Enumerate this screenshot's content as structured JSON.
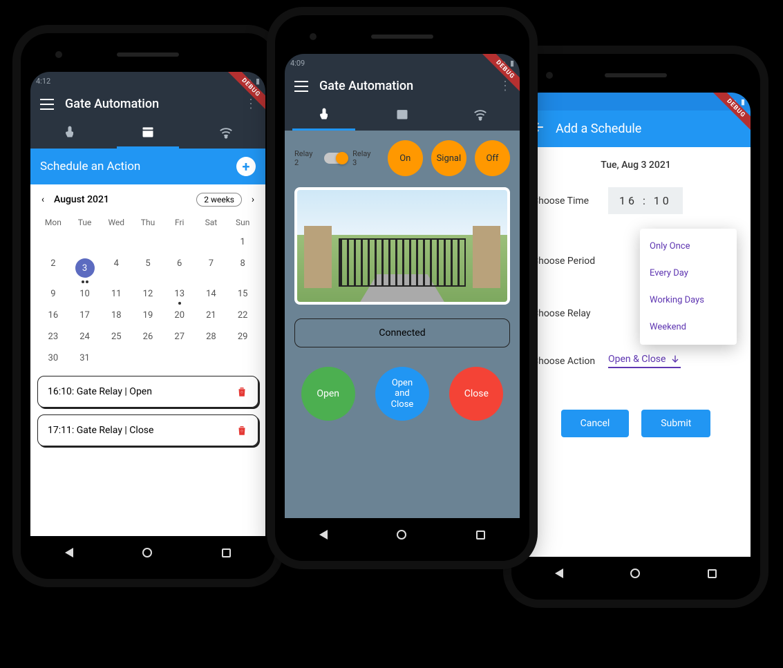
{
  "app_title": "Gate Automation",
  "debug_label": "DEBUG",
  "phone1": {
    "status_time": "4:12",
    "header": "Schedule an Action",
    "month_label": "August 2021",
    "range_chip": "2 weeks",
    "dow": [
      "Mon",
      "Tue",
      "Wed",
      "Thu",
      "Fri",
      "Sat",
      "Sun"
    ],
    "selected_day": 3,
    "event_day_with_dot": 13,
    "events": [
      "16:10: Gate Relay | Open",
      "17:11: Gate Relay | Close"
    ]
  },
  "phone2": {
    "status_time": "4:09",
    "relay_left_label": "Relay 2",
    "relay_right_label": "Relay 3",
    "btn_on": "On",
    "btn_signal": "Signal",
    "btn_off": "Off",
    "connection_status": "Connected",
    "btn_open": "Open",
    "btn_oac": "Open\nand\nClose",
    "btn_close": "Close"
  },
  "phone3": {
    "appbar_title": "Add a Schedule",
    "date_line": "Tue, Aug 3 2021",
    "choose_time_label": "Choose Time",
    "time_value": "16 : 10",
    "choose_period_label": "Choose Period",
    "period_options": [
      "Only Once",
      "Every Day",
      "Working Days",
      "Weekend"
    ],
    "choose_relay_label": "Choose Relay",
    "choose_action_label": "Choose Action",
    "action_value": "Open & Close",
    "btn_cancel": "Cancel",
    "btn_submit": "Submit"
  }
}
